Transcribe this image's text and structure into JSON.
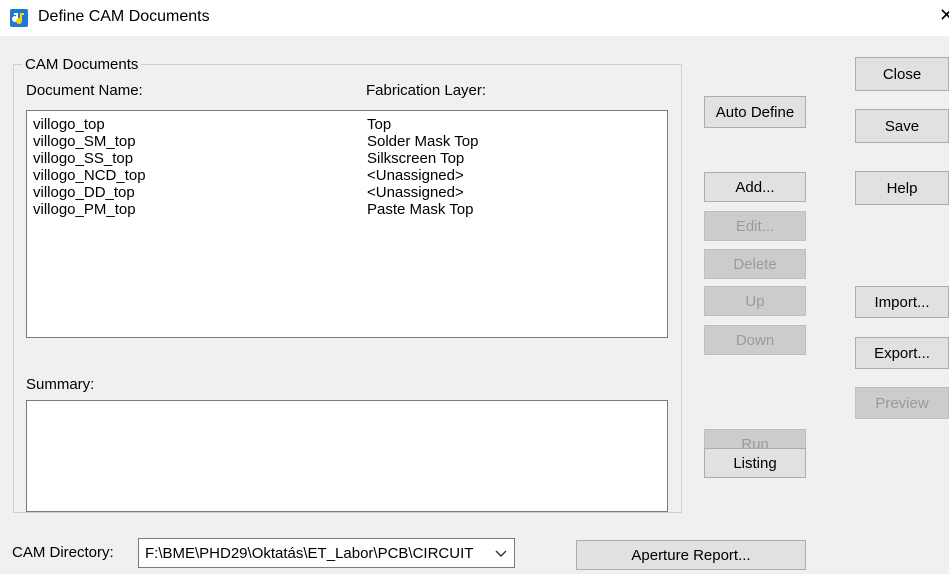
{
  "window": {
    "title": "Define CAM Documents",
    "close_glyph": "✕"
  },
  "group": {
    "title": "CAM Documents",
    "col_document": "Document Name:",
    "col_layer": "Fabrication Layer:"
  },
  "documents": [
    {
      "name": "villogo_top",
      "layer": "Top"
    },
    {
      "name": "villogo_SM_top",
      "layer": "Solder Mask Top"
    },
    {
      "name": "villogo_SS_top",
      "layer": "Silkscreen Top"
    },
    {
      "name": "villogo_NCD_top",
      "layer": "<Unassigned>"
    },
    {
      "name": "villogo_DD_top",
      "layer": "<Unassigned>"
    },
    {
      "name": "villogo_PM_top",
      "layer": "Paste Mask Top"
    }
  ],
  "summary": {
    "label": "Summary:",
    "text": ""
  },
  "buttons": {
    "auto_define": "Auto Define",
    "add": "Add...",
    "edit": "Edit...",
    "delete": "Delete",
    "up": "Up",
    "down": "Down",
    "run": "Run",
    "listing": "Listing",
    "close": "Close",
    "save": "Save",
    "help": "Help",
    "import": "Import...",
    "export": "Export...",
    "preview": "Preview",
    "aperture_report": "Aperture Report..."
  },
  "directory": {
    "label": "CAM Directory:",
    "value": "F:\\BME\\PHD29\\Oktatás\\ET_Labor\\PCB\\CIRCUIT"
  },
  "colors": {
    "app_icon": "#1e78d7",
    "window_bg": "#f0f0f0",
    "disabled_text": "#9a9a9a"
  },
  "icons": {
    "app": "app-icon",
    "combo": "chevron-down-icon"
  }
}
